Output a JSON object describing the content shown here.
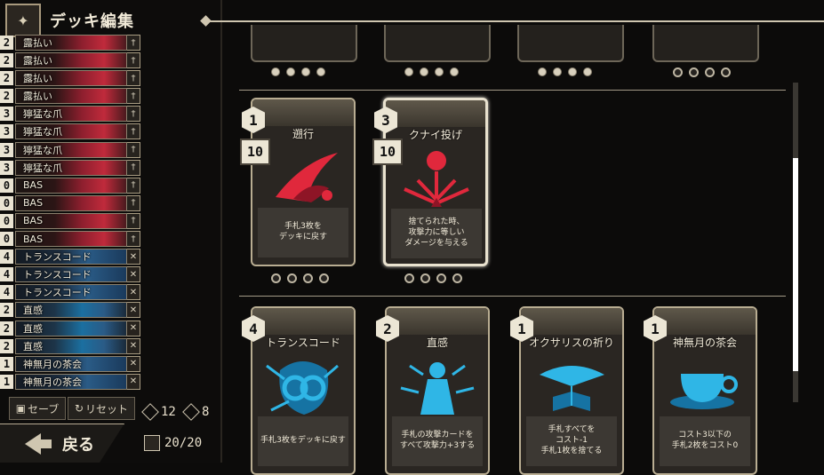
{
  "header": {
    "title": "デッキ編集"
  },
  "deck": [
    {
      "cost": "2",
      "name": "露払い",
      "color": "red"
    },
    {
      "cost": "2",
      "name": "露払い",
      "color": "red"
    },
    {
      "cost": "2",
      "name": "露払い",
      "color": "red"
    },
    {
      "cost": "2",
      "name": "露払い",
      "color": "red"
    },
    {
      "cost": "3",
      "name": "獰猛な爪",
      "color": "red"
    },
    {
      "cost": "3",
      "name": "獰猛な爪",
      "color": "red"
    },
    {
      "cost": "3",
      "name": "獰猛な爪",
      "color": "red"
    },
    {
      "cost": "3",
      "name": "獰猛な爪",
      "color": "red"
    },
    {
      "cost": "0",
      "name": "BAS",
      "color": "red"
    },
    {
      "cost": "0",
      "name": "BAS",
      "color": "red"
    },
    {
      "cost": "0",
      "name": "BAS",
      "color": "red"
    },
    {
      "cost": "0",
      "name": "BAS",
      "color": "red"
    },
    {
      "cost": "4",
      "name": "トランスコード",
      "color": "blue"
    },
    {
      "cost": "4",
      "name": "トランスコード",
      "color": "blue"
    },
    {
      "cost": "4",
      "name": "トランスコード",
      "color": "blue"
    },
    {
      "cost": "2",
      "name": "直感",
      "color": "blue"
    },
    {
      "cost": "2",
      "name": "直感",
      "color": "blue"
    },
    {
      "cost": "2",
      "name": "直感",
      "color": "blue"
    },
    {
      "cost": "1",
      "name": "神無月の茶会",
      "color": "blue"
    },
    {
      "cost": "1",
      "name": "神無月の茶会",
      "color": "blue"
    }
  ],
  "buttons": {
    "save": "セーブ",
    "reset": "リセット",
    "back": "戻る"
  },
  "stats": {
    "attack_total": "12",
    "defense_total": "8",
    "deck_count": "20/20"
  },
  "row2": [
    {
      "cost": "1",
      "attack": "10",
      "name": "遡行",
      "desc": "手札3枚を\nデッキに戻す",
      "color": "red"
    },
    {
      "cost": "3",
      "attack": "10",
      "name": "クナイ投げ",
      "desc": "捨てられた時、\n攻撃力に等しい\nダメージを与える",
      "color": "red"
    }
  ],
  "row3": [
    {
      "cost": "4",
      "name": "トランスコード",
      "desc": "手札3枚をデッキに戻す",
      "color": "blue"
    },
    {
      "cost": "2",
      "name": "直感",
      "desc": "手札の攻撃カードを\nすべて攻撃力+3する",
      "color": "blue"
    },
    {
      "cost": "1",
      "name": "オクサリスの祈り",
      "desc": "手札すべてを\nコスト-1\n手札1枚を捨てる",
      "color": "blue"
    },
    {
      "cost": "1",
      "name": "神無月の茶会",
      "desc": "コスト3以下の\n手札2枚をコスト0",
      "color": "blue"
    }
  ],
  "colors": {
    "red_accent": "#e0283c",
    "blue_accent": "#2fb6e6",
    "frame": "#b9ad92"
  },
  "icons": [
    "crest-icon",
    "save-icon",
    "reset-icon",
    "back-arrow-icon",
    "sword-icon",
    "shield-icon",
    "deck-icon",
    "move-icon"
  ]
}
